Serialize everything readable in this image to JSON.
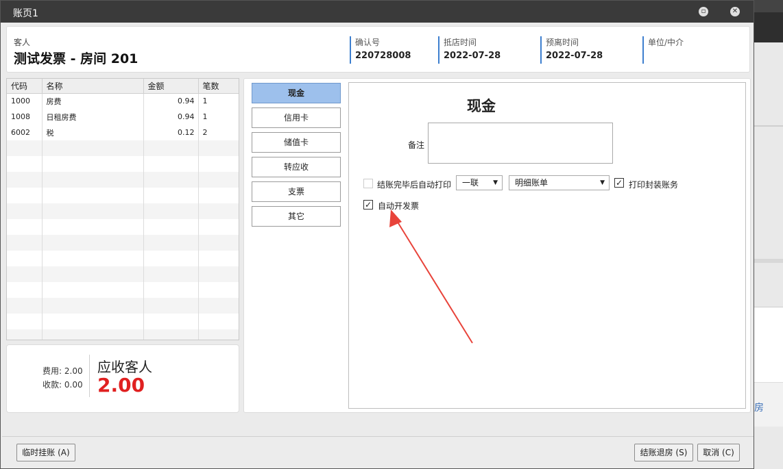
{
  "window": {
    "title": "账页1"
  },
  "header": {
    "guest_label": "客人",
    "guest_name": "测试发票 - 房间 201",
    "confirm_label": "确认号",
    "confirm_value": "220728008",
    "arrival_label": "抵店时间",
    "arrival_value": "2022-07-28",
    "departure_label": "预离时间",
    "departure_value": "2022-07-28",
    "company_label": "单位/中介"
  },
  "grid": {
    "columns": [
      "代码",
      "名称",
      "金额",
      "笔数"
    ],
    "rows": [
      {
        "code": "1000",
        "name": "房费",
        "amount": "0.94",
        "count": "1"
      },
      {
        "code": "1008",
        "name": "日租房费",
        "amount": "0.94",
        "count": "1"
      },
      {
        "code": "6002",
        "name": "税",
        "amount": "0.12",
        "count": "2"
      }
    ]
  },
  "summary": {
    "fee_label": "费用:",
    "fee_value": "2.00",
    "received_label": "收款:",
    "received_value": "0.00",
    "due_label": "应收客人",
    "due_value": "2.00"
  },
  "payment_methods": [
    "现金",
    "信用卡",
    "储值卡",
    "转应收",
    "支票",
    "其它"
  ],
  "selected_method": "现金",
  "form": {
    "title": "现金",
    "remark_label": "备注",
    "auto_print_label": "结账完毕后自动打印",
    "auto_print_checked": false,
    "copies_value": "一联",
    "bill_type_value": "明细账单",
    "print_package_label": "打印封装账务",
    "print_package_checked": true,
    "auto_invoice_label": "自动开发票",
    "auto_invoice_checked": true
  },
  "footer": {
    "temp_hold": "临时挂账 (A)",
    "checkout": "结账退房 (S)",
    "cancel": "取消 (C)"
  },
  "background": {
    "partial_text": "房"
  },
  "colors": {
    "accent": "#3d7fcf",
    "selected_button": "#9dc0ec",
    "due_amount": "#e02020",
    "annotation_arrow": "#e8433a"
  }
}
